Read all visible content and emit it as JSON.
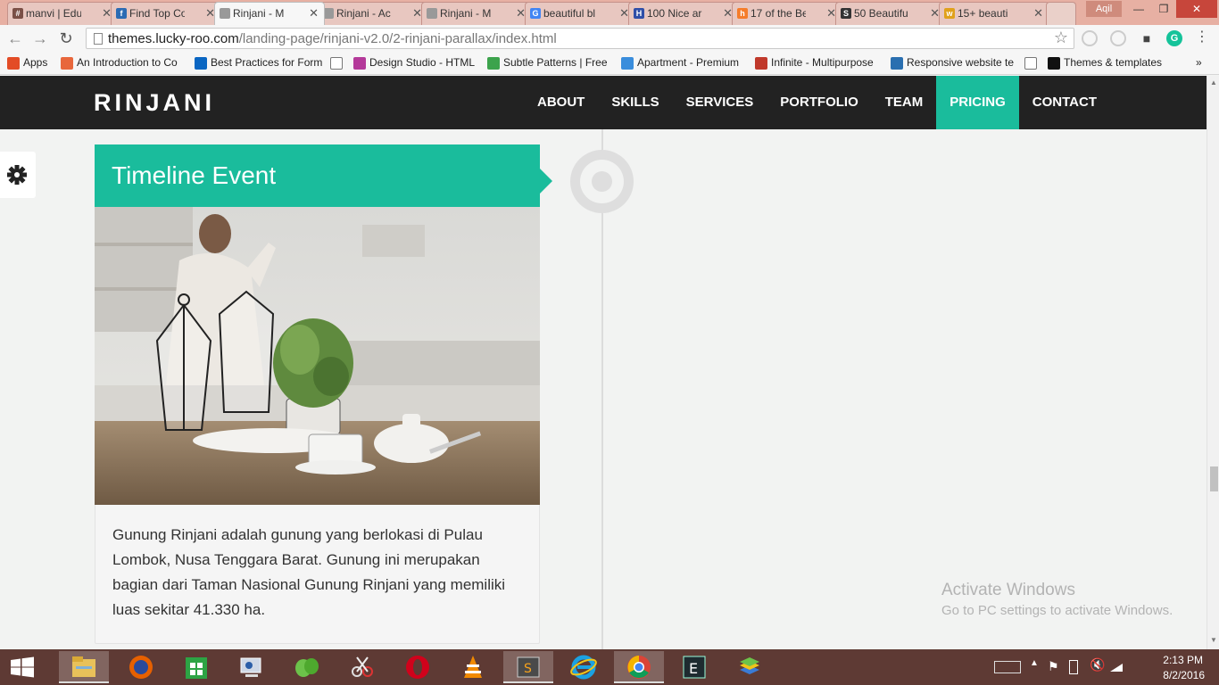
{
  "browser": {
    "tabs": [
      {
        "title": "manvi | Edu",
        "fav": "#",
        "color": "#7a4f46"
      },
      {
        "title": "Find Top Co",
        "fav": "f",
        "color": "#2c6bb3"
      },
      {
        "title": "Rinjani - M",
        "fav": "",
        "color": "#999999"
      },
      {
        "title": "Rinjani - Ac",
        "fav": "",
        "color": "#999999"
      },
      {
        "title": "Rinjani - M",
        "fav": "",
        "color": "#999999"
      },
      {
        "title": "beautiful bl",
        "fav": "G",
        "color": "#4285f4"
      },
      {
        "title": "100 Nice ar",
        "fav": "H",
        "color": "#2f4fa8"
      },
      {
        "title": "17 of the Be",
        "fav": "h",
        "color": "#f57c2a"
      },
      {
        "title": "50 Beautifu",
        "fav": "S",
        "color": "#333333"
      },
      {
        "title": "15+ beauti",
        "fav": "w",
        "color": "#e0a11b"
      }
    ],
    "user": "Aqil",
    "url_host": "themes.lucky-roo.com",
    "url_path": "/landing-page/rinjani-v2.0/2-rinjani-parallax/index.html",
    "bookmarks": [
      {
        "label": "Apps",
        "color": "#e34c26"
      },
      {
        "label": "An Introduction to Co",
        "color": "#e8673c"
      },
      {
        "label": "Best Practices for Form",
        "color": "#0a66c2"
      },
      {
        "label": "",
        "color": "#ffffff"
      },
      {
        "label": "Design Studio - HTML",
        "color": "#b4399a"
      },
      {
        "label": "Subtle Patterns | Free",
        "color": "#3ca34c"
      },
      {
        "label": "Apartment - Premium",
        "color": "#3a8ddc"
      },
      {
        "label": "Infinite - Multipurpose",
        "color": "#c0392b"
      },
      {
        "label": "Responsive website te",
        "color": "#2a6fb0"
      },
      {
        "label": "",
        "color": "#ffffff"
      },
      {
        "label": "Themes & templates",
        "color": "#111111"
      }
    ]
  },
  "site": {
    "logo": "RINJANI",
    "menu": [
      "ABOUT",
      "SKILLS",
      "SERVICES",
      "PORTFOLIO",
      "TEAM",
      "PRICING",
      "CONTACT"
    ],
    "active_menu": "PRICING",
    "accent": "#1abc9c",
    "card": {
      "title": "Timeline Event",
      "text": "Gunung Rinjani adalah gunung yang berlokasi di Pulau Lombok, Nusa Tenggara Barat. Gunung ini merupakan bagian dari Taman Nasional Gunung Rinjani yang memiliki luas sekitar 41.330 ha."
    }
  },
  "watermark": {
    "line1": "Activate Windows",
    "line2": "Go to PC settings to activate Windows."
  },
  "taskbar": {
    "time": "2:13 PM",
    "date": "8/2/2016"
  }
}
